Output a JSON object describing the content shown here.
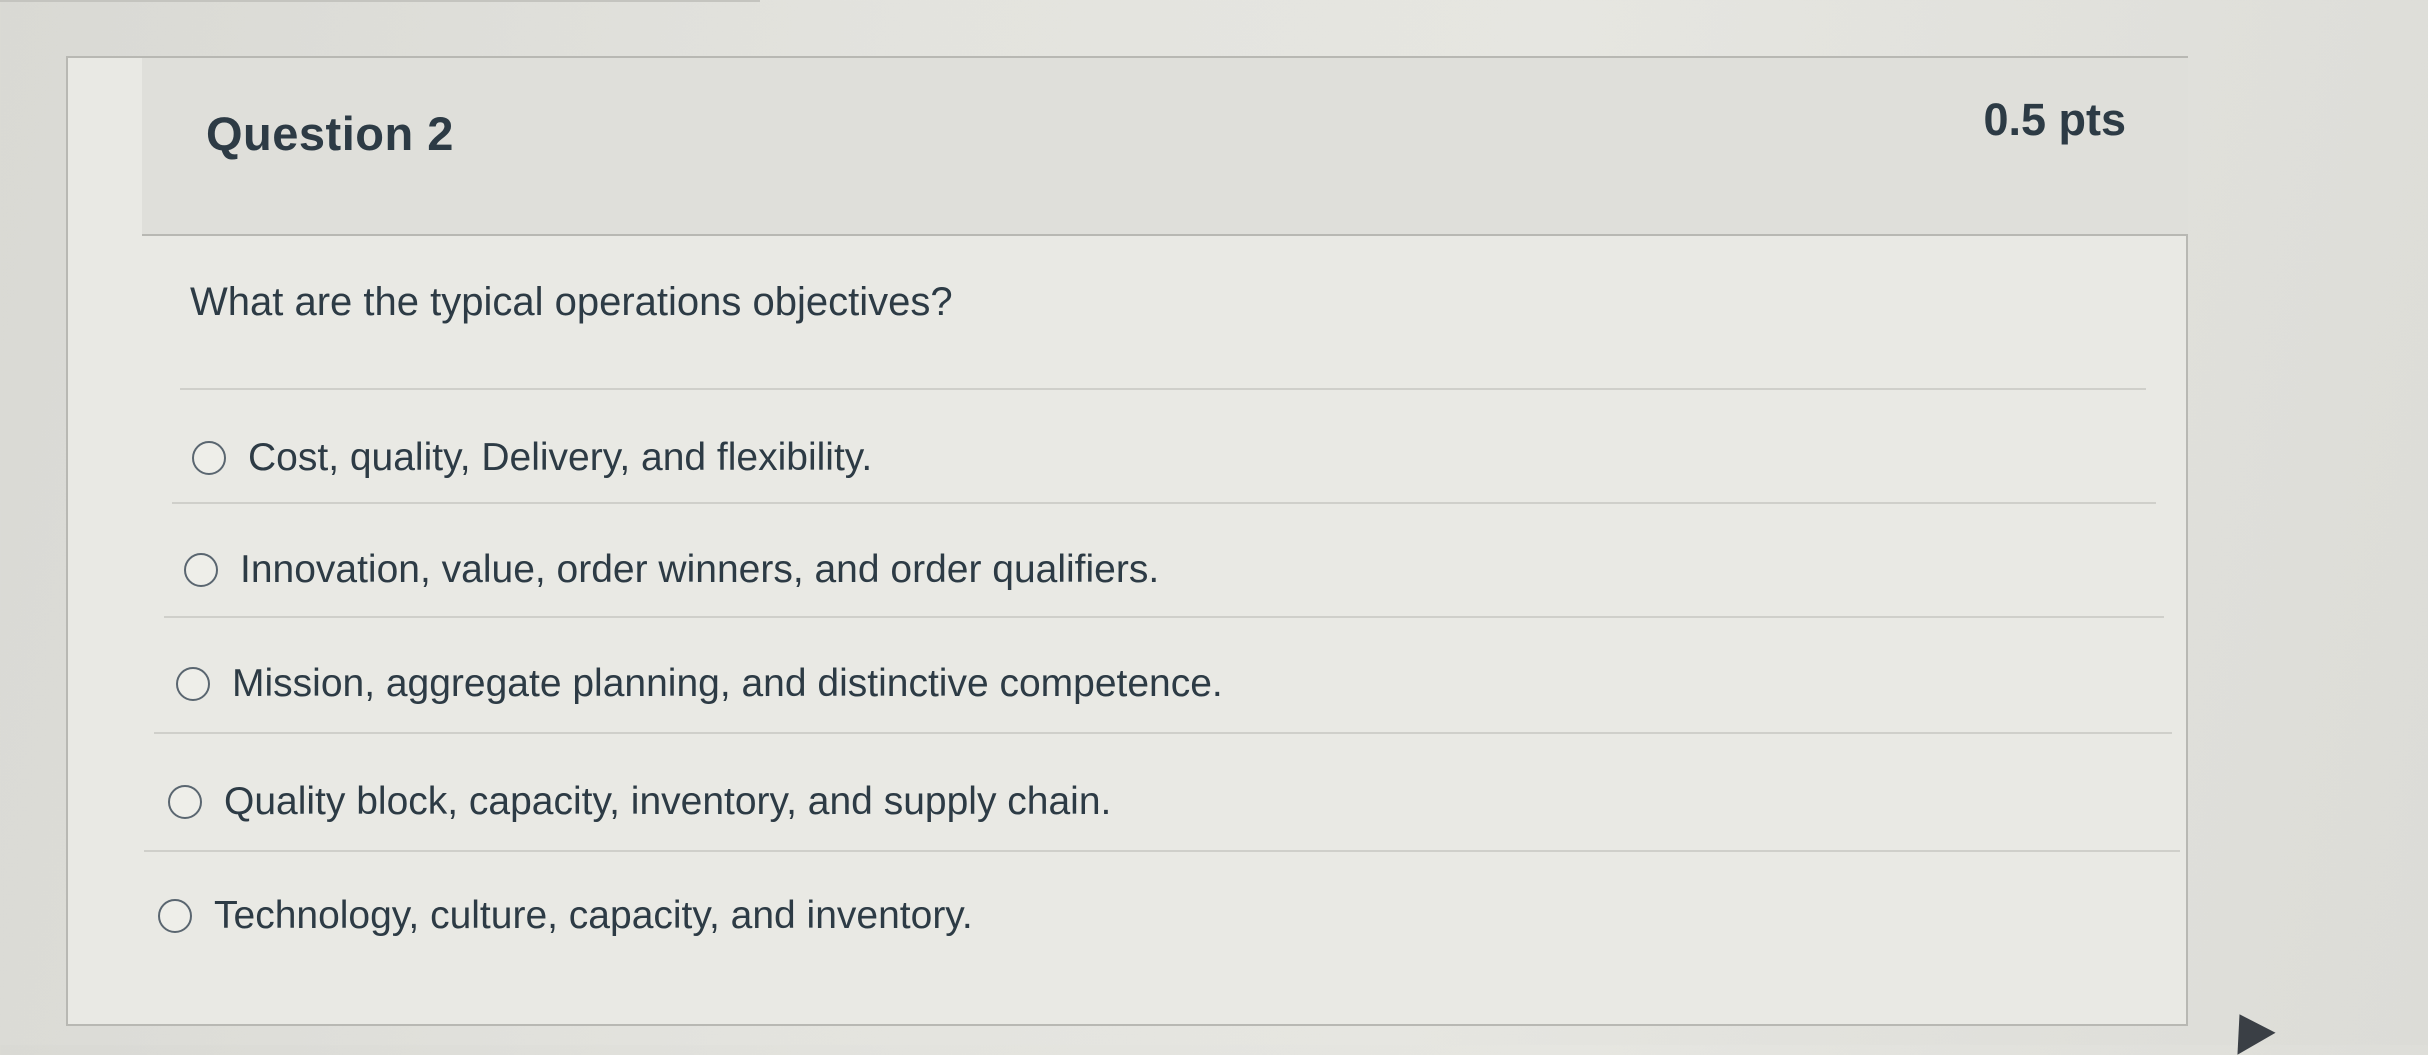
{
  "question": {
    "title": "Question 2",
    "points": "0.5 pts",
    "text": "What are the typical operations objectives?"
  },
  "answers": [
    {
      "label": "Cost, quality, Delivery, and flexibility.",
      "selected": false
    },
    {
      "label": "Innovation, value, order winners, and order qualifiers.",
      "selected": false
    },
    {
      "label": "Mission, aggregate planning, and distinctive competence.",
      "selected": false
    },
    {
      "label": "Quality block, capacity, inventory, and supply chain.",
      "selected": false
    },
    {
      "label": "Technology, culture, capacity, and inventory.",
      "selected": false
    }
  ],
  "icons": {
    "radio": "radio-button-icon",
    "cursor": "mouse-cursor-icon"
  },
  "colors": {
    "text": "#2d3b45",
    "border": "#b8b8b3",
    "header_bg": "#dfdfda"
  }
}
